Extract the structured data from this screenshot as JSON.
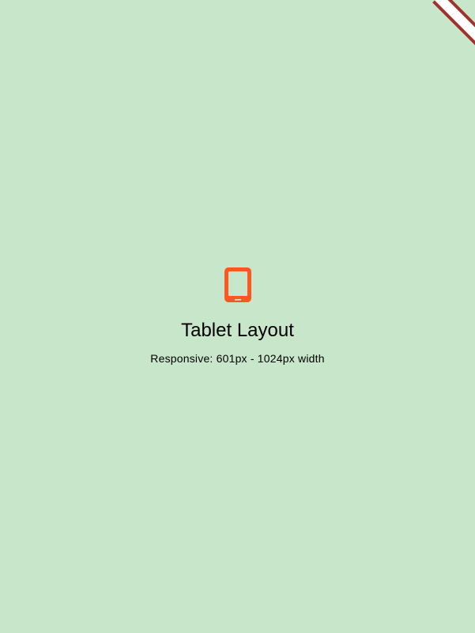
{
  "layout": {
    "icon": "tablet-icon",
    "title": "Tablet Layout",
    "subtitle": "Responsive: 601px - 1024px width"
  },
  "colors": {
    "background": "#c8e6c9",
    "icon": "#ff5722",
    "banner_border": "#a0322d"
  }
}
